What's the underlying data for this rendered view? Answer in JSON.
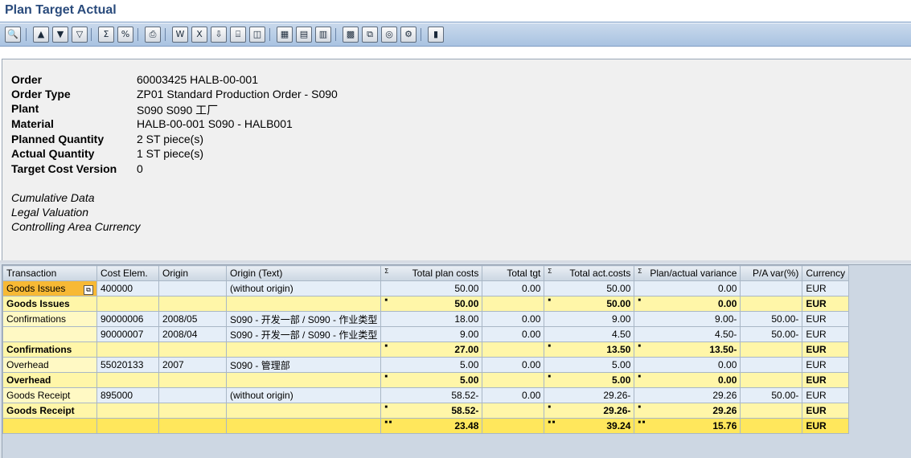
{
  "window": {
    "title": "Plan Target Actual"
  },
  "toolbar": {
    "buttons": [
      {
        "icon": "details-icon",
        "glyph": "🔍"
      },
      {
        "icon": "sort-ascending-icon",
        "glyph": "▲"
      },
      {
        "icon": "sort-descending-icon",
        "glyph": "▼"
      },
      {
        "icon": "filter-icon",
        "glyph": "▽"
      },
      {
        "icon": "total-icon",
        "glyph": "Σ"
      },
      {
        "icon": "subtotal-icon",
        "glyph": "%"
      },
      {
        "icon": "print-preview-icon",
        "glyph": "⎙"
      },
      {
        "icon": "word-processing-icon",
        "glyph": "W"
      },
      {
        "icon": "spreadsheet-icon",
        "glyph": "X"
      },
      {
        "icon": "local-file-icon",
        "glyph": "⇩"
      },
      {
        "icon": "abc-analysis-icon",
        "glyph": "⌸"
      },
      {
        "icon": "graphic-icon",
        "glyph": "◫"
      },
      {
        "icon": "choose-layout-icon",
        "glyph": "▦"
      },
      {
        "icon": "change-layout-icon",
        "glyph": "▤"
      },
      {
        "icon": "save-layout-icon",
        "glyph": "▥"
      },
      {
        "icon": "export-icon",
        "glyph": "▩"
      },
      {
        "icon": "report-interface-icon",
        "glyph": "⧉"
      },
      {
        "icon": "info-icon",
        "glyph": "◎"
      },
      {
        "icon": "settings-icon",
        "glyph": "⚙"
      },
      {
        "icon": "column-layout-icon",
        "glyph": "▮"
      }
    ]
  },
  "header": {
    "fields": [
      {
        "label": "Order",
        "value": "60003425 HALB-00-001"
      },
      {
        "label": "Order Type",
        "value": "ZP01 Standard Production Order - S090"
      },
      {
        "label": "Plant",
        "value": "S090 S090 工厂"
      },
      {
        "label": "Material",
        "value": "HALB-00-001 S090 - HALB001"
      },
      {
        "label": "Planned Quantity",
        "value": "2 ST piece(s)"
      },
      {
        "label": "Actual Quantity",
        "value": "1 ST piece(s)"
      },
      {
        "label": "Target Cost Version",
        "value": "0"
      }
    ],
    "notes": [
      "Cumulative Data",
      "Legal Valuation",
      "Controlling Area Currency"
    ]
  },
  "grid": {
    "columns": [
      "Transaction",
      "Cost Elem.",
      "Origin",
      "Origin (Text)",
      "Total plan costs",
      "Total tgt",
      "Total act.costs",
      "Plan/actual variance",
      "P/A var(%)",
      "Currency"
    ],
    "rows": [
      {
        "kind": "row",
        "selected": true,
        "cells": [
          "Goods Issues",
          "400000",
          "",
          "(without origin)",
          "50.00",
          "0.00",
          "50.00",
          "0.00",
          "",
          "EUR"
        ]
      },
      {
        "kind": "sub",
        "cells": [
          "Goods Issues",
          "",
          "",
          "",
          "50.00",
          "",
          "50.00",
          "0.00",
          "",
          "EUR"
        ]
      },
      {
        "kind": "row",
        "cells": [
          "Confirmations",
          "90000006",
          "2008/05",
          "S090 - 开发一部 / S090 - 作业类型",
          "18.00",
          "0.00",
          "9.00",
          "9.00-",
          "50.00-",
          "EUR"
        ]
      },
      {
        "kind": "row",
        "cells": [
          "",
          "90000007",
          "2008/04",
          "S090 - 开发一部 / S090 - 作业类型",
          "9.00",
          "0.00",
          "4.50",
          "4.50-",
          "50.00-",
          "EUR"
        ]
      },
      {
        "kind": "sub",
        "cells": [
          "Confirmations",
          "",
          "",
          "",
          "27.00",
          "",
          "13.50",
          "13.50-",
          "",
          "EUR"
        ]
      },
      {
        "kind": "row",
        "cells": [
          "Overhead",
          "55020133",
          "2007",
          "S090 - 管理部",
          "5.00",
          "0.00",
          "5.00",
          "0.00",
          "",
          "EUR"
        ]
      },
      {
        "kind": "sub",
        "cells": [
          "Overhead",
          "",
          "",
          "",
          "5.00",
          "",
          "5.00",
          "0.00",
          "",
          "EUR"
        ]
      },
      {
        "kind": "row",
        "cells": [
          "Goods Receipt",
          "895000",
          "",
          "(without origin)",
          "58.52-",
          "0.00",
          "29.26-",
          "29.26",
          "50.00-",
          "EUR"
        ]
      },
      {
        "kind": "sub",
        "cells": [
          "Goods Receipt",
          "",
          "",
          "",
          "58.52-",
          "",
          "29.26-",
          "29.26",
          "",
          "EUR"
        ]
      },
      {
        "kind": "tot",
        "cells": [
          "",
          "",
          "",
          "",
          "23.48",
          "",
          "39.24",
          "15.76",
          "",
          "EUR"
        ]
      }
    ]
  }
}
